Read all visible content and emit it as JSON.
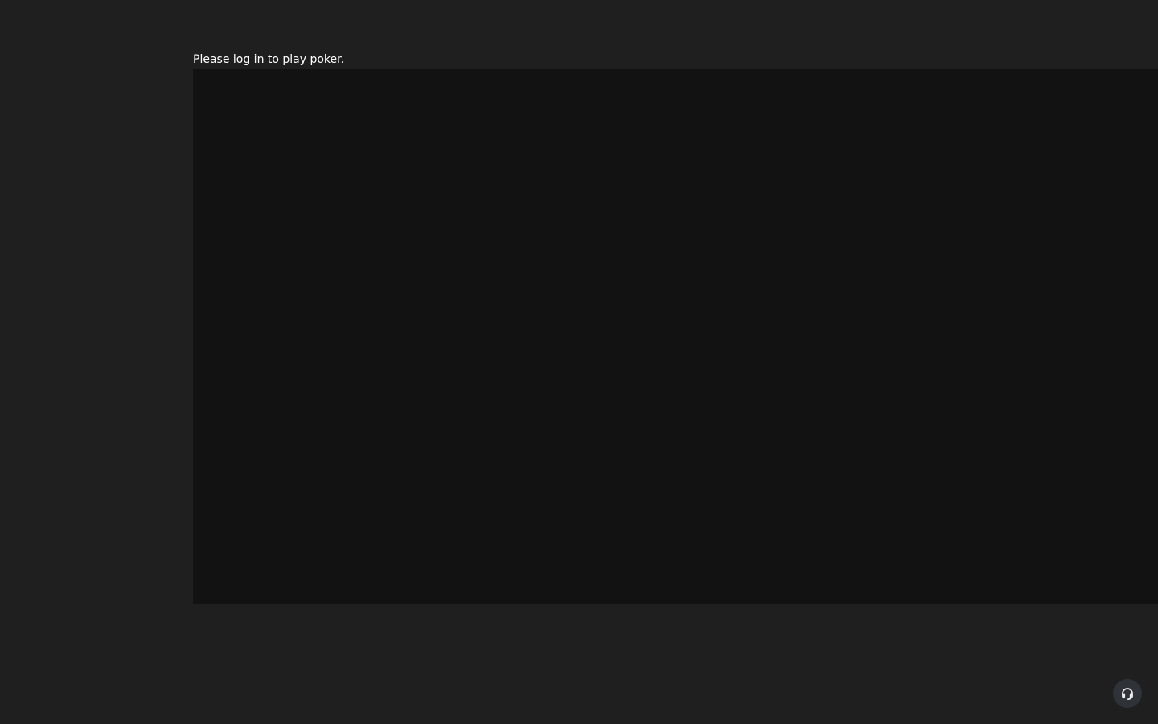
{
  "main": {
    "login_message": "Please log in to play poker."
  },
  "support": {
    "icon": "headset-icon",
    "icon_color": "#e8eaed",
    "background_color": "#2f3338"
  },
  "colors": {
    "page_background": "#1f1f1f",
    "game_frame_background": "#121212",
    "text": "#ffffff"
  }
}
